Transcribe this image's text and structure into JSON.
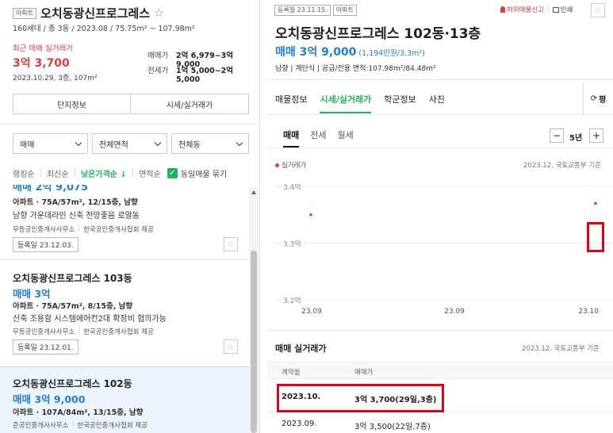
{
  "left": {
    "header": {
      "tag": "아파트",
      "title": "오치동광신프로그레스",
      "star": "☆",
      "subinfo": "160세대 / 총 3동 / 2023.08 / 75.75m² ~ 107.98m²"
    },
    "summary": {
      "recent_label": "최근 매매 실거래가",
      "recent_price": "3억 3,700",
      "recent_detail": "2023.10.29, 3층, 107m²",
      "sale_label": "매매가",
      "sale_value": "2억 6,979~3억 9,000",
      "lease_label": "전세가",
      "lease_value": "1억 5,000~2억 5,000"
    },
    "buttons": {
      "complex_info": "단지정보",
      "market_price": "시세/실거래가"
    },
    "filters": {
      "type": "매매",
      "area": "전체면적",
      "building": "전체동"
    },
    "sort": {
      "ranking": "랭킹순",
      "newest": "최신순",
      "low_price": "낮은가격순",
      "low_price_arrow": "↓",
      "area": "면적순",
      "checkbox_label": "동일매물 묶기",
      "check_mark": "✓"
    },
    "listings": [
      {
        "title_partial": "매매 2억 9,075",
        "spec": "아파트 · 75A/57m², 12/15층, 남향",
        "desc": "남향 가운데라인 신축 전망좋음 로얄동",
        "agency": "무등공인중개사사무소",
        "source": "한국공인중개사협회 제공",
        "date": "등록일 23.12.03."
      },
      {
        "title": "오치동광신프로그레스 103동",
        "price": "매매 3억",
        "spec": "아파트 · 75A/57m², 8/15층, 남향",
        "desc": "신축 조용함 시스템에어컨2대 확장비 협의가능",
        "agency": "무등공인중개사사무소",
        "source": "한국공인중개사협회 제공",
        "date": "등록일 23.12.01."
      },
      {
        "title": "오치동광신프로그레스 102동",
        "price": "매매 3억 9,000",
        "spec": "아파트 · 107A/84m², 13/15층, 남향",
        "agency": "준공인중개사사무소",
        "source": "한국공인중개사협회 제공"
      }
    ]
  },
  "right": {
    "top": {
      "reg_date": "등록일 23.11.15.",
      "tag": "아파트",
      "report_label": "허위매물신고",
      "print_label": "인쇄",
      "star": "☆"
    },
    "title": "오치동광신프로그레스 102동·13층",
    "price": "매매 3억 9,000",
    "price_per": "(1,194만원/3.3m²)",
    "facts": "남향 | 계단식 | 공급/전용 면적:107.98m²/84.48m²",
    "tabs": [
      "매물정보",
      "시세/실거래가",
      "학군정보",
      "사진"
    ],
    "refresh": "평",
    "subtabs": [
      "매매",
      "전세",
      "월세"
    ],
    "period": "5년",
    "minus": "−",
    "plus": "+",
    "chart_legend": "실거래가",
    "chart_source": "2023.12. 국토교통부 기준",
    "history_title": "매매 실거래가",
    "history_source": "2023.12. 국토교통부 기준",
    "table_headers": [
      "계약월",
      "매매가"
    ],
    "table_rows": [
      [
        "2023.10.",
        "3억 3,700(29일,3층)"
      ],
      [
        "2023.09.",
        "3억 3,500(22일,7층)"
      ]
    ]
  },
  "colors": {
    "accent_blue": "#1e7ee0",
    "accent_green": "#1fb55a",
    "red": "#e23c3c"
  },
  "chart_data": {
    "type": "scatter",
    "title": "",
    "xlabel": "",
    "ylabel": "",
    "y_ticks": [
      "3.4억",
      "3.3억",
      "3.2억"
    ],
    "x_ticks": [
      "23.09",
      "23.09",
      "23.10"
    ],
    "ylim": [
      3.2,
      3.4
    ],
    "series": [
      {
        "name": "실거래가",
        "points": [
          {
            "x": "23.09",
            "y": 3.35
          },
          {
            "x": "23.10",
            "y": 3.37
          }
        ]
      }
    ]
  }
}
